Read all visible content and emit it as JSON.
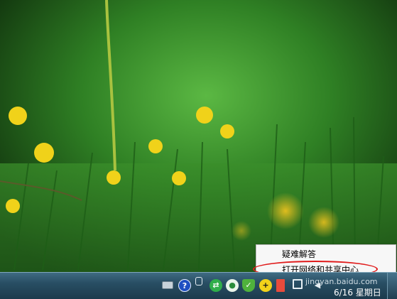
{
  "context_menu": {
    "items": [
      {
        "label": "疑难解答"
      },
      {
        "label": "打开网络和共享中心"
      }
    ]
  },
  "taskbar": {
    "tray_icons": [
      "keyboard-icon",
      "help-icon",
      "network-small-icon",
      "green-app-icon",
      "chat-icon",
      "shield-icon",
      "plus-icon",
      "flag-icon",
      "network-icon",
      "volume-icon"
    ],
    "clock_date": "6/16 星期日"
  },
  "watermark": "jingyan.baidu.com",
  "colors": {
    "highlight_ellipse": "#e01b1b",
    "taskbar": "#284e63"
  }
}
